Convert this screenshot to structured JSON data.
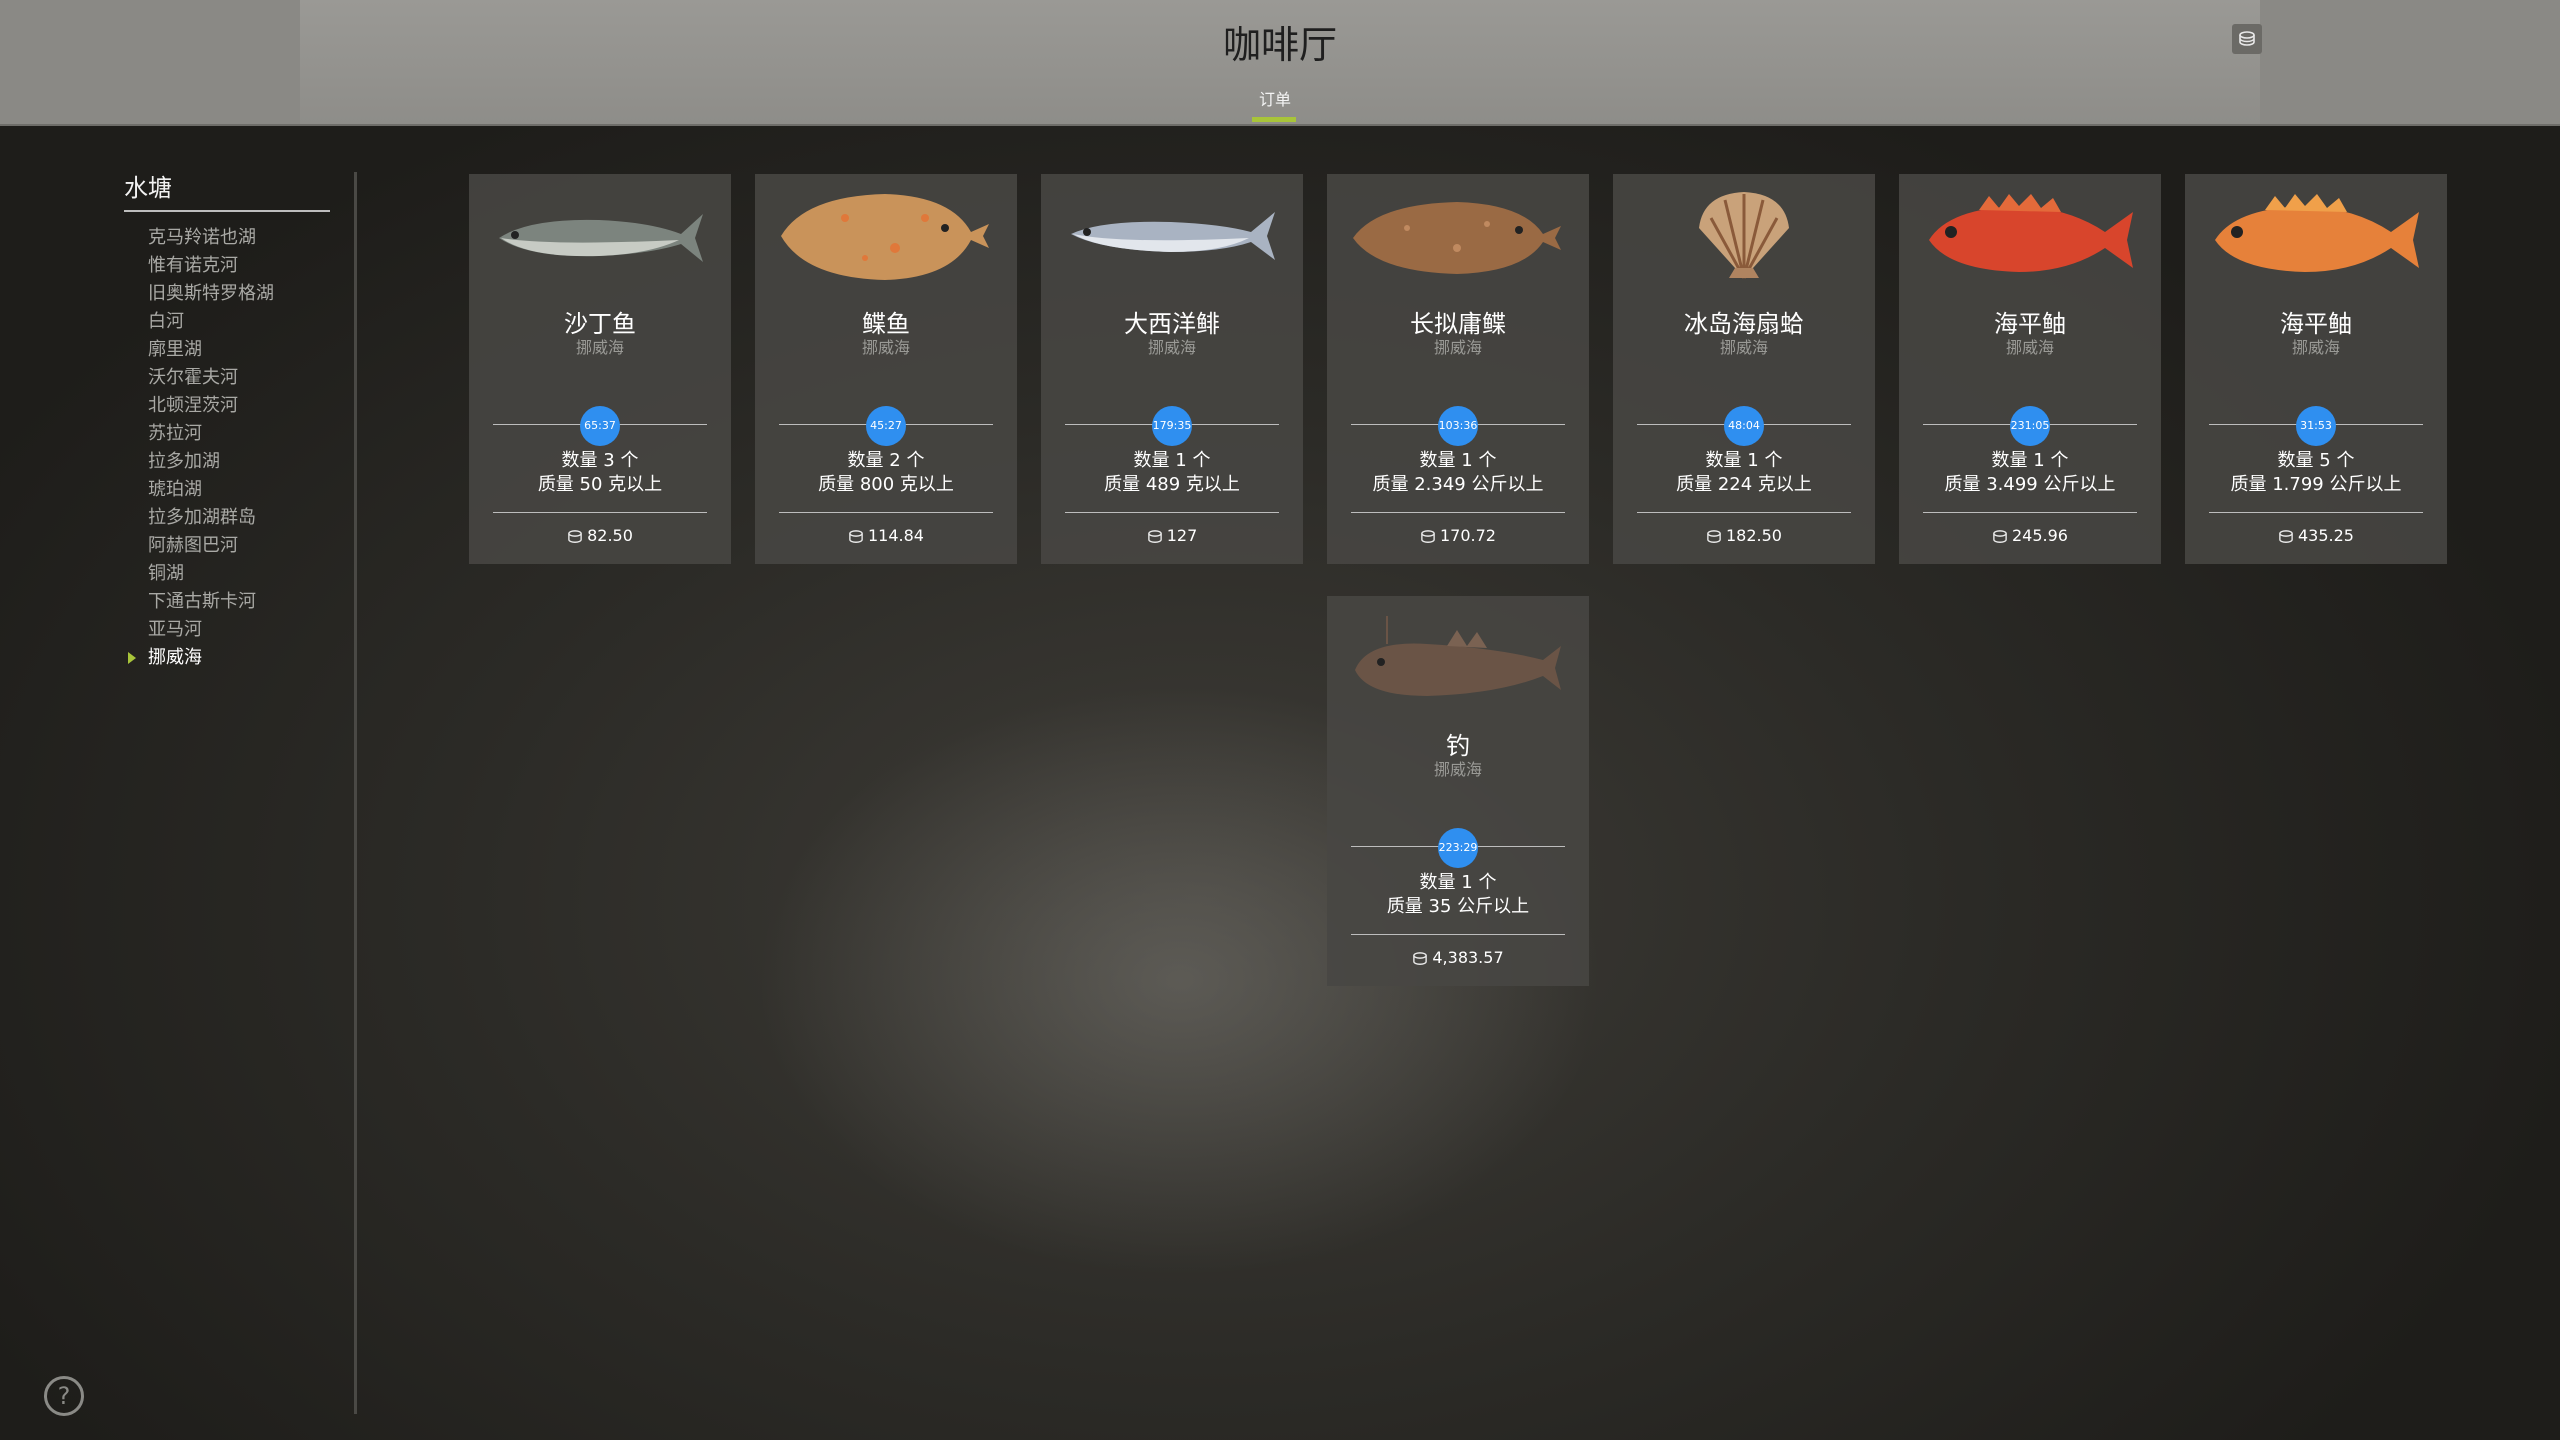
{
  "header": {
    "title": "咖啡厅",
    "tabs": [
      {
        "label": "订单",
        "active": true
      }
    ],
    "accent_color": "#a8c43a"
  },
  "sidebar": {
    "title": "水塘",
    "items": [
      {
        "label": "克马羚诺也湖",
        "active": false
      },
      {
        "label": "惟有诺克河",
        "active": false
      },
      {
        "label": "旧奥斯特罗格湖",
        "active": false
      },
      {
        "label": "白河",
        "active": false
      },
      {
        "label": "廓里湖",
        "active": false
      },
      {
        "label": "沃尔霍夫河",
        "active": false
      },
      {
        "label": "北顿涅茨河",
        "active": false
      },
      {
        "label": "苏拉河",
        "active": false
      },
      {
        "label": "拉多加湖",
        "active": false
      },
      {
        "label": "琥珀湖",
        "active": false
      },
      {
        "label": "拉多加湖群岛",
        "active": false
      },
      {
        "label": "阿赫图巴河",
        "active": false
      },
      {
        "label": "铜湖",
        "active": false
      },
      {
        "label": "下通古斯卡河",
        "active": false
      },
      {
        "label": "亚马河",
        "active": false
      },
      {
        "label": "挪威海",
        "active": true
      }
    ]
  },
  "orders": [
    {
      "name": "沙丁鱼",
      "location": "挪威海",
      "timer": "65:37",
      "quantity": "数量 3 个",
      "mass": "质量 50 克以上",
      "reward": "82.50",
      "icon": "sardine-icon"
    },
    {
      "name": "鲽鱼",
      "location": "挪威海",
      "timer": "45:27",
      "quantity": "数量 2 个",
      "mass": "质量 800 克以上",
      "reward": "114.84",
      "icon": "plaice-icon"
    },
    {
      "name": "大西洋鲱",
      "location": "挪威海",
      "timer": "179:35",
      "quantity": "数量 1 个",
      "mass": "质量 489 克以上",
      "reward": "127",
      "icon": "herring-icon"
    },
    {
      "name": "长拟庸鲽",
      "location": "挪威海",
      "timer": "103:36",
      "quantity": "数量 1 个",
      "mass": "质量 2.349 公斤以上",
      "reward": "170.72",
      "icon": "flounder-icon"
    },
    {
      "name": "冰岛海扇蛤",
      "location": "挪威海",
      "timer": "48:04",
      "quantity": "数量 1 个",
      "mass": "质量 224 克以上",
      "reward": "182.50",
      "icon": "scallop-icon"
    },
    {
      "name": "海平鲉",
      "location": "挪威海",
      "timer": "231:05",
      "quantity": "数量 1 个",
      "mass": "质量 3.499 公斤以上",
      "reward": "245.96",
      "icon": "redfish-icon"
    },
    {
      "name": "海平鲉",
      "location": "挪威海",
      "timer": "31:53",
      "quantity": "数量 5 个",
      "mass": "质量 1.799 公斤以上",
      "reward": "435.25",
      "icon": "redfish-icon"
    },
    {
      "name": "钓",
      "location": "挪威海",
      "timer": "223:29",
      "quantity": "数量 1 个",
      "mass": "质量 35 公斤以上",
      "reward": "4,383.57",
      "icon": "monkfish-icon"
    }
  ],
  "colors": {
    "timer": "#2f8ff0",
    "accent": "#a8c43a"
  }
}
